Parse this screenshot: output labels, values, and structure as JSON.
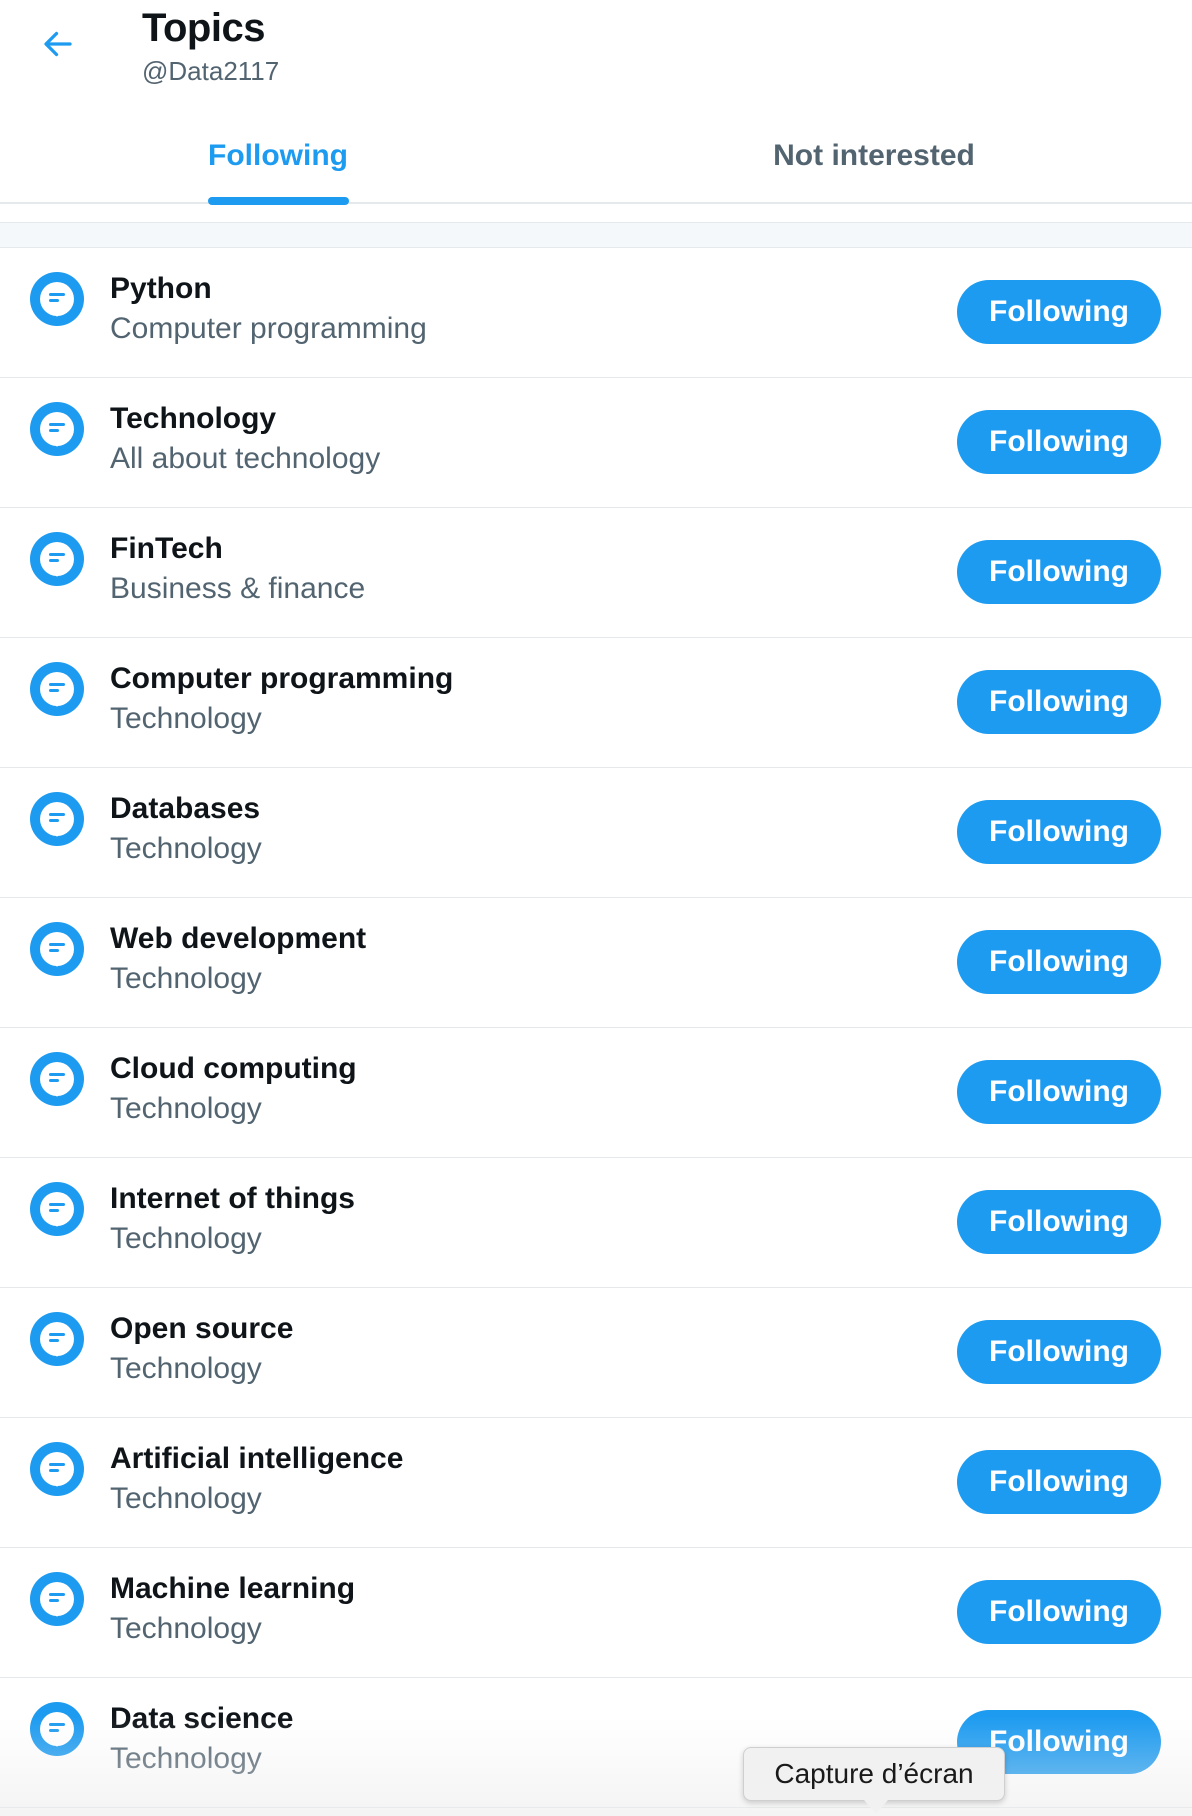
{
  "header": {
    "title": "Topics",
    "handle": "@Data2117"
  },
  "tabs": [
    {
      "label": "Following",
      "active": true
    },
    {
      "label": "Not interested",
      "active": false
    }
  ],
  "colors": {
    "accent": "#1d9bf0",
    "text_primary": "#0f1419",
    "text_secondary": "#536471"
  },
  "topics": [
    {
      "name": "Python",
      "category": "Computer programming",
      "button": "Following"
    },
    {
      "name": "Technology",
      "category": "All about technology",
      "button": "Following"
    },
    {
      "name": "FinTech",
      "category": "Business & finance",
      "button": "Following"
    },
    {
      "name": "Computer programming",
      "category": "Technology",
      "button": "Following"
    },
    {
      "name": "Databases",
      "category": "Technology",
      "button": "Following"
    },
    {
      "name": "Web development",
      "category": "Technology",
      "button": "Following"
    },
    {
      "name": "Cloud computing",
      "category": "Technology",
      "button": "Following"
    },
    {
      "name": "Internet of things",
      "category": "Technology",
      "button": "Following"
    },
    {
      "name": "Open source",
      "category": "Technology",
      "button": "Following"
    },
    {
      "name": "Artificial intelligence",
      "category": "Technology",
      "button": "Following"
    },
    {
      "name": "Machine learning",
      "category": "Technology",
      "button": "Following"
    },
    {
      "name": "Data science",
      "category": "Technology",
      "button": "Following"
    }
  ],
  "tooltip": {
    "text": "Capture d’écran"
  },
  "icons": {
    "back": "back-arrow-icon",
    "topic": "topic-speech-bubble-icon"
  }
}
